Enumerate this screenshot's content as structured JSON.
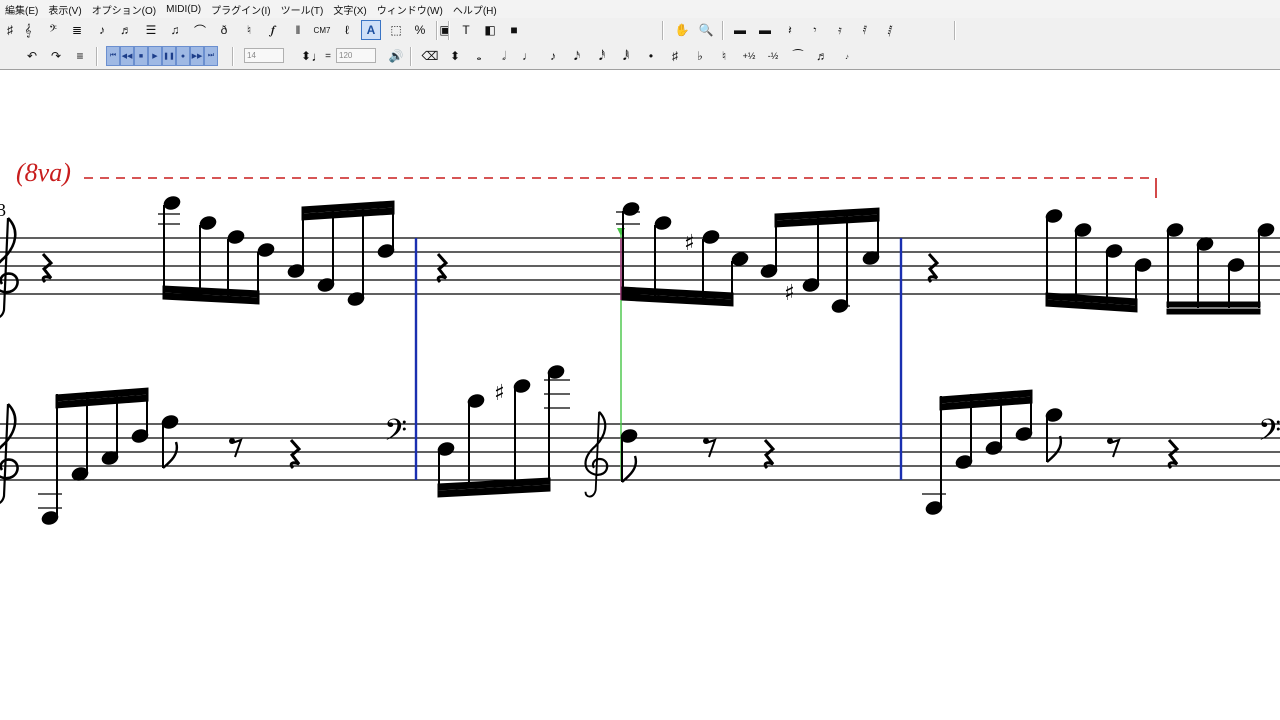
{
  "menu": [
    "編集(E)",
    "表示(V)",
    "オプション(O)",
    "MIDI(D)",
    "プラグイン(I)",
    "ツール(T)",
    "文字(X)",
    "ウィンドウ(W)",
    "ヘルプ(H)"
  ],
  "toolbar1": [
    {
      "name": "partial-edge-icon",
      "glyph": "♯"
    },
    {
      "name": "clef-tool-icon",
      "glyph": "𝄞"
    },
    {
      "name": "bass-clef-tool-icon",
      "glyph": "𝄢"
    },
    {
      "name": "staff-tool-icon",
      "glyph": "≣"
    },
    {
      "name": "note-entry-icon",
      "glyph": "♪"
    },
    {
      "name": "tuplet-tool-icon",
      "glyph": "♬"
    },
    {
      "name": "layers-tool-icon",
      "glyph": "☰"
    },
    {
      "name": "beam-tool-icon",
      "glyph": "♫"
    },
    {
      "name": "slur-tool-icon",
      "glyph": "⌒"
    },
    {
      "name": "tempo-tool-icon",
      "glyph": "ð"
    },
    {
      "name": "articulation-tool-icon",
      "glyph": "♮"
    },
    {
      "name": "expression-tool-icon",
      "glyph": "𝆑"
    },
    {
      "name": "repeat-tool-icon",
      "glyph": "‖"
    },
    {
      "name": "chord-tool-icon",
      "glyph": "CM7"
    },
    {
      "name": "lyrics-tool-icon",
      "glyph": "ℓ"
    },
    {
      "name": "text-tool-icon",
      "glyph": "A"
    },
    {
      "name": "selection-tool-icon",
      "glyph": "⬚"
    },
    {
      "name": "resize-tool-icon",
      "glyph": "%"
    },
    {
      "name": "page-layout-icon",
      "glyph": "▣"
    },
    {
      "name": "special-tools-icon",
      "glyph": "T"
    },
    {
      "name": "mirror-tool-icon",
      "glyph": "◧"
    },
    {
      "name": "color-tool-icon",
      "glyph": "■"
    },
    {
      "name": "hand-grabber-icon",
      "glyph": "✋"
    },
    {
      "name": "zoom-tool-icon",
      "glyph": "🔍"
    },
    {
      "name": "whole-rest-icon",
      "glyph": "▬"
    },
    {
      "name": "half-rest-icon",
      "glyph": "▬"
    },
    {
      "name": "quarter-rest-icon",
      "glyph": "𝄽"
    },
    {
      "name": "eighth-rest-icon",
      "glyph": "𝄾"
    },
    {
      "name": "sixteenth-rest-icon",
      "glyph": "𝄿"
    },
    {
      "name": "thirtysecond-rest-icon",
      "glyph": "𝅀"
    },
    {
      "name": "sixtyfourth-rest-icon",
      "glyph": "𝅁"
    }
  ],
  "toolbar2": {
    "field1": "14",
    "field2": "120",
    "tempo_equals": "="
  },
  "toolbar2_buttons": [
    {
      "name": "undo-icon",
      "glyph": "↶"
    },
    {
      "name": "redo-icon",
      "glyph": "↷"
    },
    {
      "name": "list-icon",
      "glyph": "≡"
    },
    {
      "name": "rewind-start-icon",
      "glyph": "⏮"
    },
    {
      "name": "rewind-icon",
      "glyph": "◀◀"
    },
    {
      "name": "stop-icon",
      "glyph": "■"
    },
    {
      "name": "play-icon",
      "glyph": "▶"
    },
    {
      "name": "pause-icon",
      "glyph": "❚❚"
    },
    {
      "name": "record-icon",
      "glyph": "●"
    },
    {
      "name": "fast-forward-icon",
      "glyph": "▶▶"
    },
    {
      "name": "forward-end-icon",
      "glyph": "⏭"
    },
    {
      "name": "speaker-icon",
      "glyph": "🔊"
    },
    {
      "name": "eraser-icon",
      "glyph": "⌫"
    },
    {
      "name": "updown-icon",
      "glyph": "⬍"
    },
    {
      "name": "whole-note-icon",
      "glyph": "𝅝"
    },
    {
      "name": "half-note-icon",
      "glyph": "𝅗𝅥"
    },
    {
      "name": "quarter-note-icon",
      "glyph": "♩"
    },
    {
      "name": "eighth-note-icon",
      "glyph": "♪"
    },
    {
      "name": "sixteenth-note-icon",
      "glyph": "𝅘𝅥𝅯"
    },
    {
      "name": "thirtysecond-note-icon",
      "glyph": "𝅘𝅥𝅰"
    },
    {
      "name": "sixtyfourth-note-icon",
      "glyph": "𝅘𝅥𝅱"
    },
    {
      "name": "dot-icon",
      "glyph": "•"
    },
    {
      "name": "sharp-icon",
      "glyph": "♯"
    },
    {
      "name": "flat-icon",
      "glyph": "♭"
    },
    {
      "name": "natural-icon",
      "glyph": "♮"
    },
    {
      "name": "raise-half-step-icon",
      "glyph": "+½"
    },
    {
      "name": "lower-half-step-icon",
      "glyph": "-½"
    },
    {
      "name": "tie-icon",
      "glyph": "⁀"
    },
    {
      "name": "beam-icon",
      "glyph": "♬"
    },
    {
      "name": "grace-note-icon",
      "glyph": "𝆔"
    }
  ],
  "score": {
    "ottava": "(8va)",
    "measure_number": "3"
  },
  "colors": {
    "ottava": "#c81d1d",
    "barline": "#1a2fb0",
    "cursor": "#44c444",
    "selection": "#a0307a"
  }
}
